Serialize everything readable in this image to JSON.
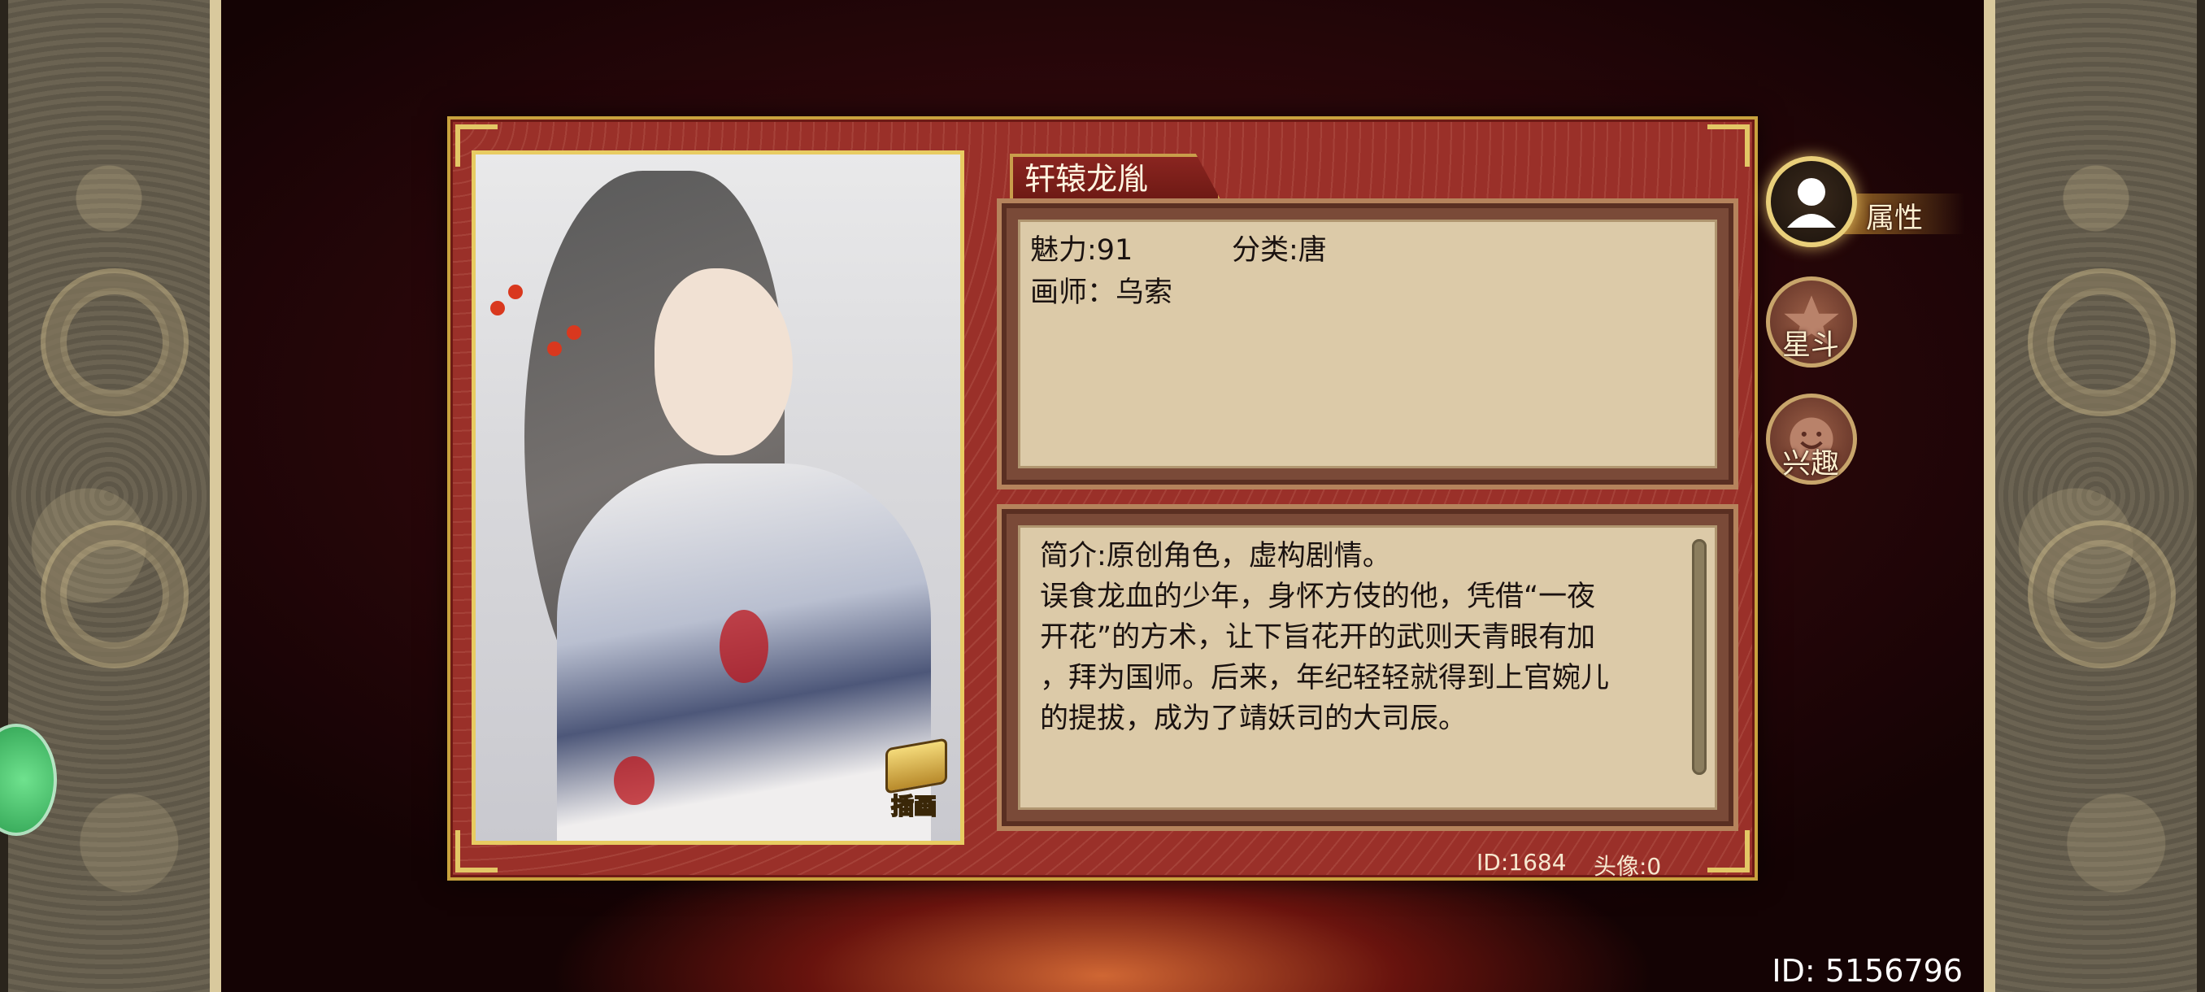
{
  "character": {
    "name": "轩辕龙胤",
    "charm": "魅力:91",
    "category": "分类:唐",
    "artist": "画师：乌索",
    "intro": [
      "简介:原创角色，虚构剧情。",
      "误食龙血的少年，身怀方伎的他，凭借“一夜",
      "开花”的方术，让下旨花开的武则天青眼有加",
      "，拜为国师。后来，年纪轻轻就得到上官婉儿",
      "的提拔，成为了靖妖司的大司辰。"
    ],
    "id_label": "ID:1684",
    "avatar_label": "头像:0"
  },
  "portrait": {
    "illustration_button": "插画",
    "illustration_icon": "scroll-icon"
  },
  "side_tabs": [
    {
      "label": "属性",
      "icon": "person-icon",
      "active": true
    },
    {
      "label": "星斗",
      "icon": "star-icon",
      "active": false
    },
    {
      "label": "兴趣",
      "icon": "smile-icon",
      "active": false
    }
  ],
  "account": {
    "id": "ID: 5156796"
  },
  "colors": {
    "card_red": "#9a3029",
    "gold_border": "#c9a23e",
    "parchment": "#dccaa8"
  }
}
